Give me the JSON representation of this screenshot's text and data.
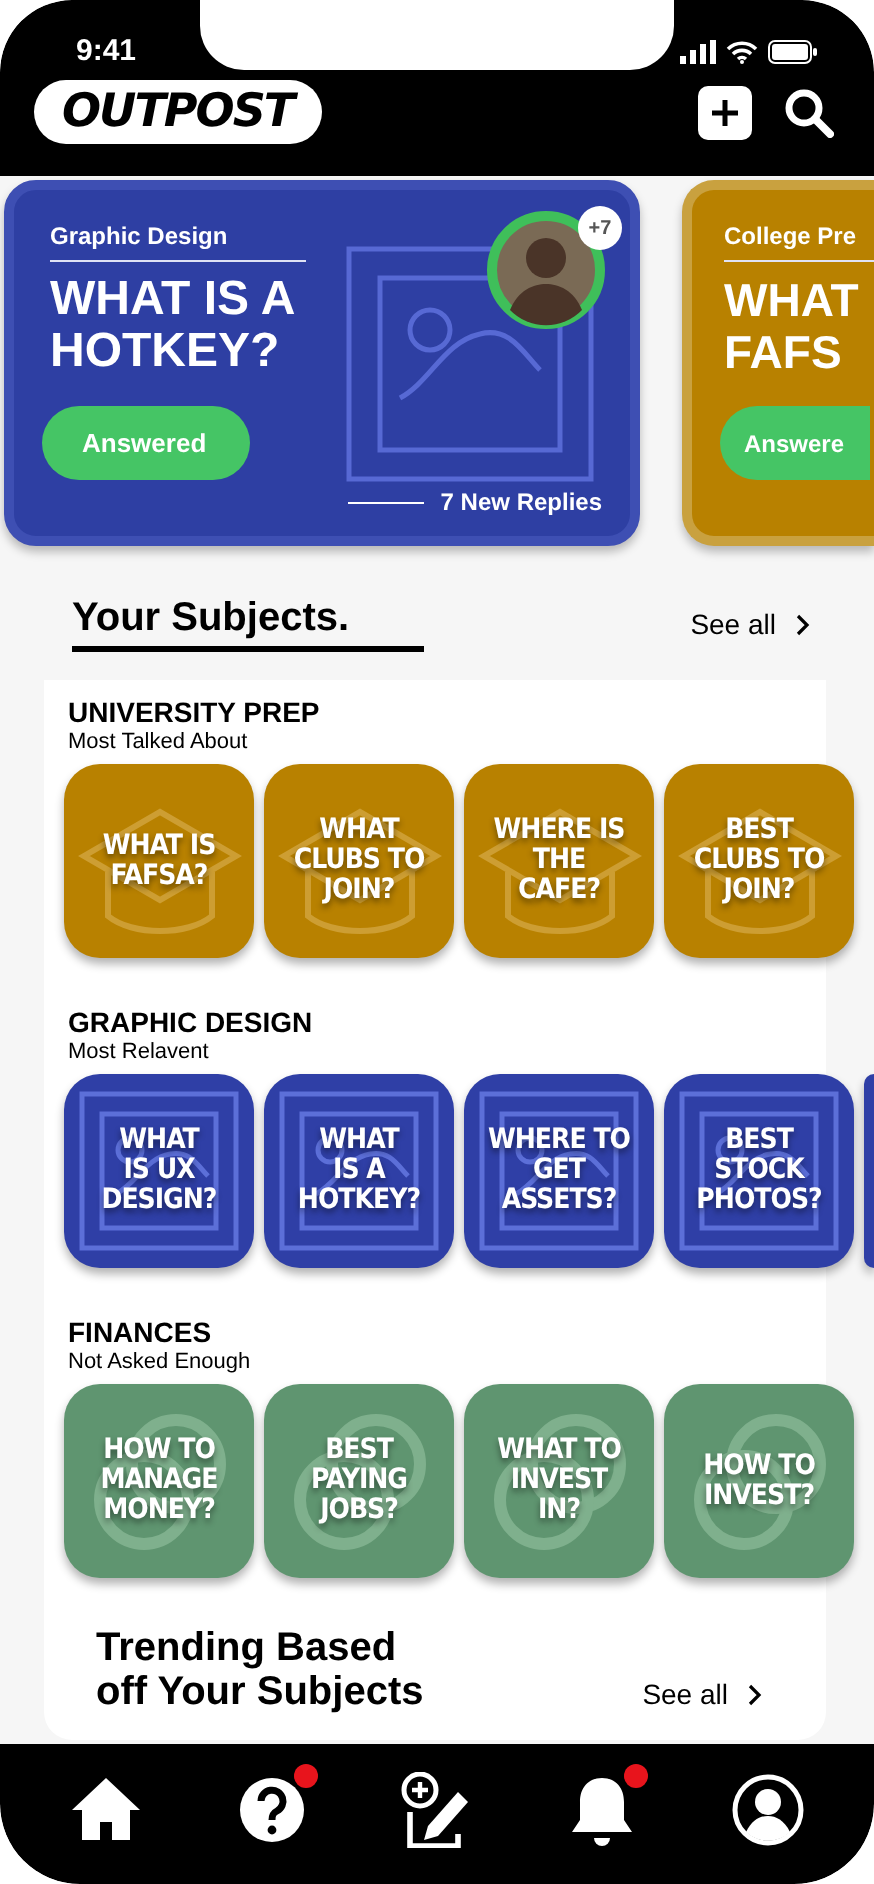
{
  "status_bar": {
    "time": "9:41"
  },
  "header": {
    "logo": "OUTPOST"
  },
  "featured": [
    {
      "category": "Graphic Design",
      "title_lines": [
        "WHAT IS A",
        "HOTKEY?"
      ],
      "button": "Answered",
      "kind": "design",
      "extra_count": "+7",
      "replies": "7 New Replies"
    },
    {
      "category": "College Pre",
      "title_lines": [
        "WHAT",
        "FAFS"
      ],
      "button": "Answere",
      "kind": "prep"
    }
  ],
  "subjects": {
    "title": "Your Subjects.",
    "see_all": "See all",
    "sections": [
      {
        "name": "UNIVERSITY PREP",
        "subtitle": "Most Talked About",
        "kind": "prep",
        "tiles": [
          "WHAT IS\nFAFSA?",
          "WHAT\nCLUBS TO\nJOIN?",
          "WHERE IS\nTHE\nCAFE?",
          "BEST\nCLUBS TO\nJOIN?"
        ]
      },
      {
        "name": "GRAPHIC DESIGN",
        "subtitle": "Most Relavent",
        "kind": "design",
        "has_more": true,
        "tiles": [
          "WHAT\nIS UX\nDESIGN?",
          "WHAT\nIS A\nHOTKEY?",
          "WHERE TO\nGET\nASSETS?",
          "BEST\nSTOCK\nPHOTOS?"
        ]
      },
      {
        "name": "FINANCES",
        "subtitle": "Not Asked Enough",
        "kind": "finance",
        "tiles": [
          "HOW TO\nMANAGE\nMONEY?",
          "BEST\nPAYING\nJOBS?",
          "WHAT TO\nINVEST\nIN?",
          "HOW TO\nINVEST?"
        ]
      }
    ]
  },
  "trending": {
    "title": "Trending Based off Your Subjects",
    "see_all": "See all"
  },
  "bottom_nav": [
    {
      "kind": "home",
      "badge": false
    },
    {
      "kind": "questions",
      "badge": true
    },
    {
      "kind": "compose",
      "badge": false
    },
    {
      "kind": "notifications",
      "badge": true
    },
    {
      "kind": "profile",
      "badge": false
    }
  ]
}
